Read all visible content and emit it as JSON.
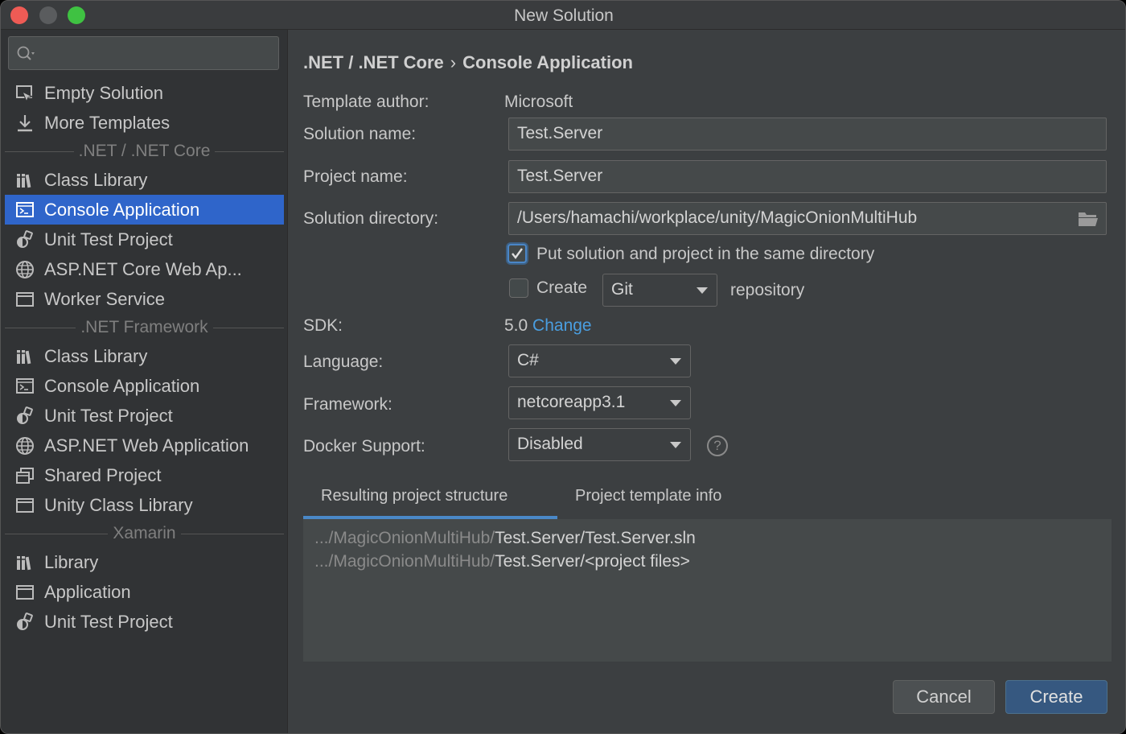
{
  "window": {
    "title": "New Solution"
  },
  "sidebar": {
    "search": {
      "placeholder": ""
    },
    "top_items": [
      {
        "label": "Empty Solution",
        "icon": "empty-solution-icon"
      },
      {
        "label": "More Templates",
        "icon": "download-icon"
      }
    ],
    "groups": [
      {
        "label": ".NET / .NET Core",
        "items": [
          {
            "label": "Class Library",
            "icon": "library-icon"
          },
          {
            "label": "Console Application",
            "icon": "console-icon",
            "selected": true
          },
          {
            "label": "Unit Test Project",
            "icon": "unit-test-icon"
          },
          {
            "label": "ASP.NET Core Web Ap...",
            "icon": "globe-icon"
          },
          {
            "label": "Worker Service",
            "icon": "window-icon"
          }
        ]
      },
      {
        "label": ".NET Framework",
        "items": [
          {
            "label": "Class Library",
            "icon": "library-icon"
          },
          {
            "label": "Console Application",
            "icon": "console-icon"
          },
          {
            "label": "Unit Test Project",
            "icon": "unit-test-icon"
          },
          {
            "label": "ASP.NET Web Application",
            "icon": "globe-icon"
          },
          {
            "label": "Shared Project",
            "icon": "shared-project-icon"
          },
          {
            "label": "Unity Class Library",
            "icon": "window-icon"
          }
        ]
      },
      {
        "label": "Xamarin",
        "items": [
          {
            "label": "Library",
            "icon": "library-icon"
          },
          {
            "label": "Application",
            "icon": "window-icon"
          },
          {
            "label": "Unit Test Project",
            "icon": "unit-test-icon"
          }
        ]
      }
    ]
  },
  "main": {
    "breadcrumb": {
      "parent": ".NET / .NET Core",
      "separator": "›",
      "current": "Console Application"
    },
    "template_author": {
      "label": "Template author:",
      "value": "Microsoft"
    },
    "solution_name": {
      "label": "Solution name:",
      "value": "Test.Server"
    },
    "project_name": {
      "label": "Project name:",
      "value": "Test.Server"
    },
    "solution_directory": {
      "label": "Solution directory:",
      "value": "/Users/hamachi/workplace/unity/MagicOnionMultiHub"
    },
    "same_directory": {
      "label": "Put solution and project in the same directory",
      "checked": true
    },
    "create_repo": {
      "label": "Create",
      "checked": false,
      "vcs": "Git",
      "suffix": "repository"
    },
    "sdk": {
      "label": "SDK:",
      "value": "5.0",
      "link": "Change"
    },
    "language": {
      "label": "Language:",
      "value": "C#"
    },
    "framework": {
      "label": "Framework:",
      "value": "netcoreapp3.1"
    },
    "docker": {
      "label": "Docker Support:",
      "value": "Disabled",
      "help": "?"
    },
    "tabs": [
      {
        "label": "Resulting project structure",
        "active": true
      },
      {
        "label": "Project template info",
        "active": false
      }
    ],
    "structure": [
      {
        "prefix": ".../MagicOnionMultiHub/",
        "path": "Test.Server/Test.Server.sln"
      },
      {
        "prefix": ".../MagicOnionMultiHub/",
        "path": "Test.Server/<project files>"
      }
    ]
  },
  "footer": {
    "cancel_label": "Cancel",
    "create_label": "Create"
  },
  "colors": {
    "selection": "#2f65ca",
    "link": "#4a9ee0",
    "primary_button": "#365880",
    "tab_underline": "#4a88c7"
  }
}
